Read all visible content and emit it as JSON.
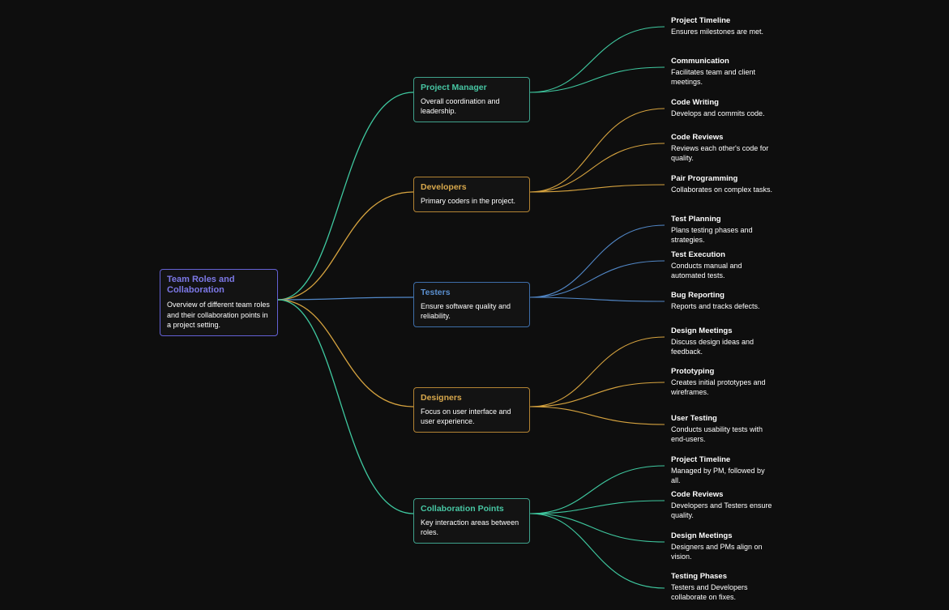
{
  "root": {
    "title": "Team Roles and Collaboration",
    "desc": "Overview of different team roles and their collaboration points in a project setting."
  },
  "branches": [
    {
      "key": "pm",
      "title": "Project Manager",
      "desc": "Overall coordination and leadership.",
      "color": "#3fc9a0",
      "leaves": [
        {
          "title": "Project Timeline",
          "desc": "Ensures milestones are met."
        },
        {
          "title": "Communication",
          "desc": "Facilitates team and client meetings."
        }
      ]
    },
    {
      "key": "dev",
      "title": "Developers",
      "desc": "Primary coders in the project.",
      "color": "#d6a33f",
      "leaves": [
        {
          "title": "Code Writing",
          "desc": "Develops and commits code."
        },
        {
          "title": "Code Reviews",
          "desc": "Reviews each other's code for quality."
        },
        {
          "title": "Pair Programming",
          "desc": "Collaborates on complex tasks."
        }
      ]
    },
    {
      "key": "test",
      "title": "Testers",
      "desc": "Ensure software quality and reliability.",
      "color": "#5288c8",
      "leaves": [
        {
          "title": "Test Planning",
          "desc": "Plans testing phases and strategies."
        },
        {
          "title": "Test Execution",
          "desc": "Conducts manual and automated tests."
        },
        {
          "title": "Bug Reporting",
          "desc": "Reports and tracks defects."
        }
      ]
    },
    {
      "key": "des",
      "title": "Designers",
      "desc": "Focus on user interface and user experience.",
      "color": "#d6a33f",
      "leaves": [
        {
          "title": "Design Meetings",
          "desc": "Discuss design ideas and feedback."
        },
        {
          "title": "Prototyping",
          "desc": "Creates initial prototypes and wireframes."
        },
        {
          "title": "User Testing",
          "desc": "Conducts usability tests with end-users."
        }
      ]
    },
    {
      "key": "coll",
      "title": "Collaboration Points",
      "desc": "Key interaction areas between roles.",
      "color": "#3fc9a0",
      "leaves": [
        {
          "title": "Project Timeline",
          "desc": "Managed by PM, followed by all."
        },
        {
          "title": "Code Reviews",
          "desc": "Developers and Testers ensure quality."
        },
        {
          "title": "Design Meetings",
          "desc": "Designers and PMs align on vision."
        },
        {
          "title": "Testing Phases",
          "desc": "Testers and Developers collaborate on fixes."
        }
      ]
    }
  ],
  "chart_data": {
    "type": "tree",
    "root": "Team Roles and Collaboration",
    "children": [
      {
        "name": "Project Manager",
        "children": [
          "Project Timeline",
          "Communication"
        ]
      },
      {
        "name": "Developers",
        "children": [
          "Code Writing",
          "Code Reviews",
          "Pair Programming"
        ]
      },
      {
        "name": "Testers",
        "children": [
          "Test Planning",
          "Test Execution",
          "Bug Reporting"
        ]
      },
      {
        "name": "Designers",
        "children": [
          "Design Meetings",
          "Prototyping",
          "User Testing"
        ]
      },
      {
        "name": "Collaboration Points",
        "children": [
          "Project Timeline",
          "Code Reviews",
          "Design Meetings",
          "Testing Phases"
        ]
      }
    ]
  }
}
